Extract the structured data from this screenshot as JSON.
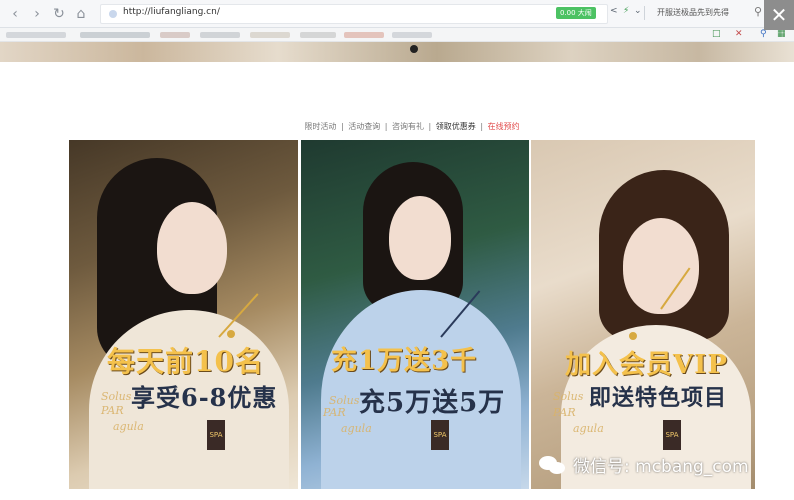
{
  "browser": {
    "url": "http://liufangliang.cn/",
    "speed_badge": "0.00 大闹",
    "promo_text": "开服送极品先到先得",
    "close_symbol": "✕",
    "icons": {
      "back": "chevron-left-icon",
      "forward": "chevron-right-icon",
      "reload": "reload-icon",
      "home": "home-icon",
      "search": "search-icon",
      "close": "close-icon"
    }
  },
  "nav_links": [
    {
      "label": "限时活动",
      "style": "normal"
    },
    {
      "label": "活动查询",
      "style": "normal"
    },
    {
      "label": "咨询有礼",
      "style": "normal"
    },
    {
      "label": "领取优惠券",
      "style": "strong"
    },
    {
      "label": "在线预约",
      "style": "highlight"
    }
  ],
  "nav_separator": "|",
  "cards": [
    {
      "headline_1": "每天前10名",
      "headline_2": "享受6-8优惠",
      "deco": [
        "Solus",
        "PAR",
        "agula"
      ],
      "tag": "SPA"
    },
    {
      "headline_1": "充1万送3千",
      "headline_2": "充5万送5万",
      "deco": [
        "Solus",
        "PAR",
        "agula"
      ],
      "tag": "SPA"
    },
    {
      "headline_1": "加入会员VIP",
      "headline_2": "即送特色项目",
      "deco": [
        "Solus",
        "PAR",
        "agula"
      ],
      "tag": "SPA"
    }
  ],
  "watermark": "微信号: mcbang_com",
  "colors": {
    "accent_green": "#4cc263",
    "gold": "#f4c14c",
    "highlight_red": "#e24b4b"
  }
}
